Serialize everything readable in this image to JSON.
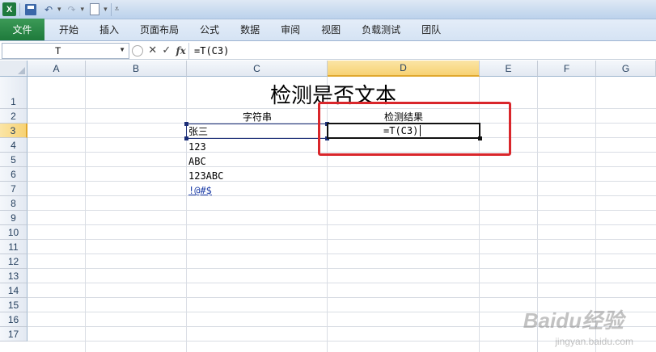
{
  "quick_access": {
    "app_icon": "X",
    "icons": [
      "excel-icon",
      "save-icon",
      "undo-icon",
      "redo-icon",
      "print-preview-icon",
      "customize-icon"
    ]
  },
  "ribbon": {
    "file_tab": "文件",
    "tabs": [
      "开始",
      "插入",
      "页面布局",
      "公式",
      "数据",
      "审阅",
      "视图",
      "负载测试",
      "团队"
    ]
  },
  "formula_bar": {
    "name_box": "T",
    "formula": "=T(C3)"
  },
  "sheet": {
    "columns": [
      "A",
      "B",
      "C",
      "D",
      "E",
      "F",
      "G"
    ],
    "rows": [
      "1",
      "2",
      "3",
      "4",
      "5",
      "6",
      "7",
      "8",
      "9",
      "10",
      "11",
      "12",
      "13",
      "14",
      "15",
      "16",
      "17"
    ],
    "selected_column": "D",
    "selected_row": "3",
    "title": "检测是否文本",
    "header_c2": "字符串",
    "header_d2": "检测结果",
    "c3": "张三",
    "c4": "123",
    "c5": "ABC",
    "c6": "123ABC",
    "c7": "!@#$",
    "d3_edit": "=T(C3)"
  },
  "watermark": {
    "main": "Baidu经验",
    "sub": "jingyan.baidu.com"
  },
  "colors": {
    "file_tab": "#1e7a3b",
    "callout": "#d9262b",
    "selected_header": "#f7d274",
    "link": "#1f3fa8"
  }
}
